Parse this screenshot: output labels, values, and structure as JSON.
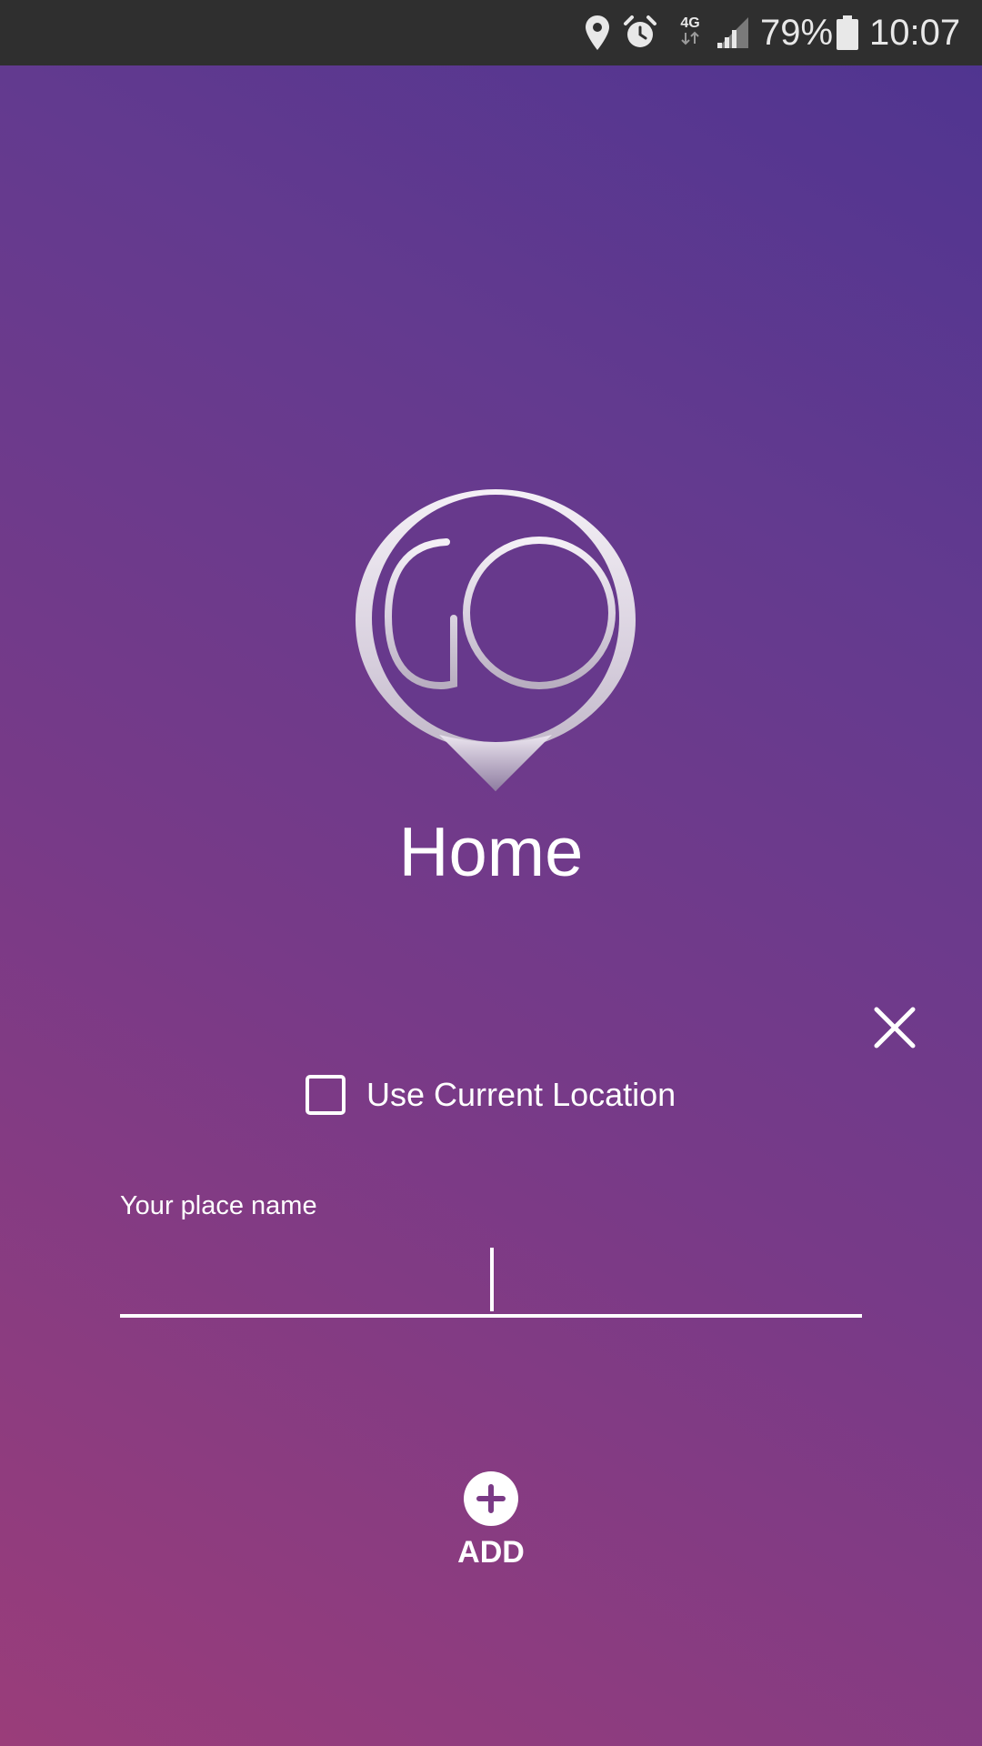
{
  "status_bar": {
    "network_label": "4G",
    "battery_percent": "79%",
    "time": "10:07",
    "icons": [
      "location-icon",
      "alarm-icon",
      "network-4g-icon",
      "signal-icon",
      "battery-icon"
    ]
  },
  "logo": {
    "text": "GO"
  },
  "title": "Home",
  "use_current_location": {
    "label": "Use Current Location",
    "checked": false
  },
  "place_name": {
    "label": "Your place name",
    "value": ""
  },
  "add_button": {
    "label": "ADD",
    "icon": "plus-circle-icon"
  },
  "colors": {
    "status_bar_bg": "#2f2f2f",
    "gradient_top": "#4e3490",
    "gradient_mid": "#773a88",
    "gradient_bottom": "#9a3d7a",
    "foreground": "#ffffff",
    "add_icon_plus": "#7a3a86"
  }
}
